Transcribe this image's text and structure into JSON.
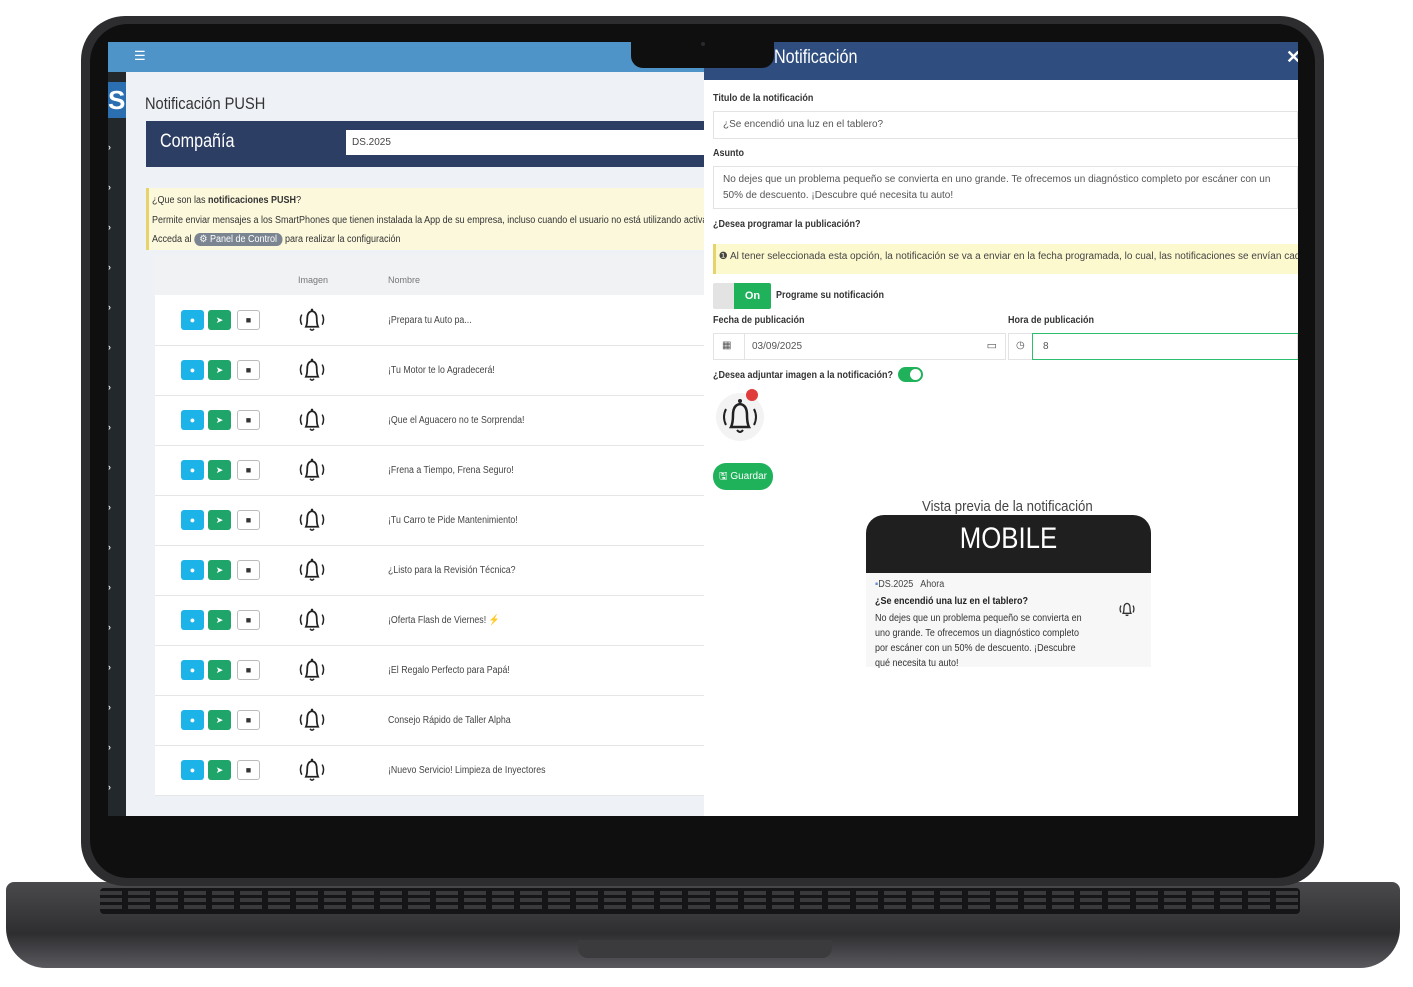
{
  "app": {
    "page_title": "Notificación PUSH",
    "company_label": "Compañía",
    "company_value": "DS.2025"
  },
  "info": {
    "q_prefix": "¿Que son las ",
    "q_bold": "notificaciones PUSH",
    "q_suffix": "?",
    "desc": "Permite enviar mensajes a los SmartPhones que tienen instalada la App de su empresa, incluso cuando el usuario no está utilizando activar",
    "access_prefix": "Acceda al",
    "panel_button": "Panel de Control",
    "access_suffix": "para realizar la configuración"
  },
  "table": {
    "columns": [
      "Imagen",
      "Nombre"
    ],
    "rows": [
      "¡Prepara tu Auto pa...",
      "¡Tu Motor te lo Agradecerá!",
      "¡Que el Aguacero no te Sorprenda!",
      "¡Frena a Tiempo, Frena Seguro!",
      "¡Tu Carro te Pide Mantenimiento!",
      "¿Listo para la Revisión Técnica?",
      "¡Oferta Flash de Viernes! ⚡",
      "¡El Regalo Perfecto para Papá!",
      "Consejo Rápido de Taller Alpha",
      "¡Nuevo Servicio! Limpieza de Inyectores"
    ]
  },
  "modal": {
    "title": "Notificación",
    "title_label": "Titulo de la notificación",
    "title_value": "¿Se encendió una luz en el tablero?",
    "subject_label": "Asunto",
    "subject_value": "No dejes que un problema pequeño se convierta en uno grande. Te ofrecemos un diagnóstico completo por escáner con un 50% de descuento. ¡Descubre qué necesita tu auto!",
    "schedule_q": "¿Desea programar la publicación?",
    "schedule_warn": "Al tener seleccionada esta opción, la notificación se va a enviar en la fecha programada, lo cual, las notificaciones se envían cada hora.",
    "toggle_on": "On",
    "toggle_label": "Programe su notificación",
    "date_label": "Fecha de publicación",
    "date_value": "03/09/2025",
    "hour_label": "Hora de publicación",
    "hour_value": "8",
    "attach_q": "¿Desea adjuntar imagen a la notificación?",
    "save_label": "Guardar"
  },
  "preview": {
    "title": "Vista previa de la notificación",
    "device": "MOBILE",
    "app_name": "DS.2025",
    "time": "Ahora",
    "n_title": "¿Se encendió una luz en el tablero?",
    "n_body": "No dejes que un problema pequeño se convierta en uno grande. Te ofrecemos un diagnóstico completo por escáner con un 50% de descuento. ¡Descubre qué necesita tu auto!"
  }
}
